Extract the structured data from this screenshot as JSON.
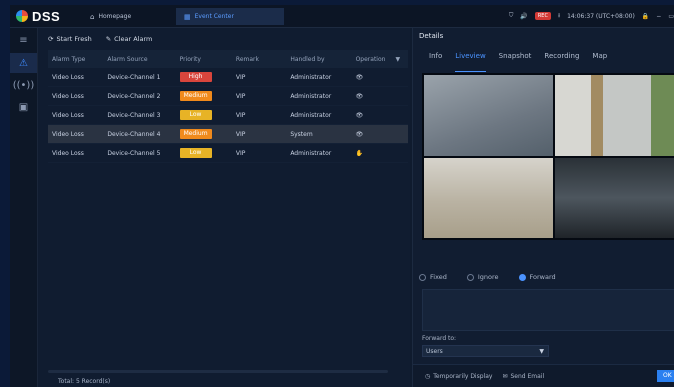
{
  "app": {
    "name": "DSS"
  },
  "topbar": {
    "tabs": [
      {
        "label": "Homepage",
        "icon": "home-icon"
      },
      {
        "label": "Event Center",
        "icon": "grid-icon"
      }
    ],
    "time": "14:06:37 (UTC+08:00)",
    "rec_badge": "REC"
  },
  "toolbar": {
    "start_fresh": "Start Fresh",
    "clear_alarm": "Clear Alarm"
  },
  "table": {
    "headers": [
      "Alarm Type",
      "Alarm Source",
      "Priority",
      "Remark",
      "Handled by",
      "Operation"
    ],
    "rows": [
      {
        "type": "Video Loss",
        "source": "Device-Channel 1",
        "priority": "High",
        "priority_color": "#d9453c",
        "remark": "VIP",
        "handled_by": "Administrator"
      },
      {
        "type": "Video Loss",
        "source": "Device-Channel 2",
        "priority": "Medium",
        "priority_color": "#f08a1c",
        "remark": "VIP",
        "handled_by": "Administrator"
      },
      {
        "type": "Video Loss",
        "source": "Device-Channel 3",
        "priority": "Low",
        "priority_color": "#e7b326",
        "remark": "VIP",
        "handled_by": "Administrator"
      },
      {
        "type": "Video Loss",
        "source": "Device-Channel 4",
        "priority": "Medium",
        "priority_color": "#f08a1c",
        "remark": "VIP",
        "handled_by": "System"
      },
      {
        "type": "Video Loss",
        "source": "Device-Channel 5",
        "priority": "Low",
        "priority_color": "#e7b326",
        "remark": "VIP",
        "handled_by": "Administrator"
      }
    ],
    "total": "Total: 5 Record(s)"
  },
  "details": {
    "title": "Details",
    "tabs": [
      "Info",
      "Liveview",
      "Snapshot",
      "Recording",
      "Map"
    ],
    "active_tab": "Liveview",
    "radio": [
      "Fixed",
      "Ignore",
      "Forward"
    ],
    "selected_radio": "Forward",
    "forward_label": "Forward to:",
    "forward_value": "Users",
    "temp_display": "Temporarily Display",
    "send_email": "Send Email",
    "ok": "OK"
  }
}
